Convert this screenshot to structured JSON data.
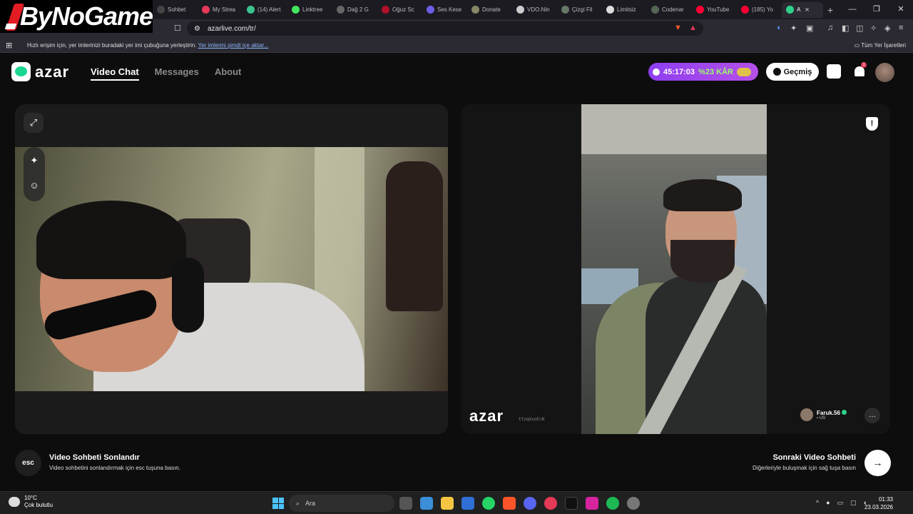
{
  "overlay": {
    "logo": "ByNoGame"
  },
  "tabs": [
    {
      "label": "Sohbet",
      "color": "#444444"
    },
    {
      "label": "My Strea",
      "color": "#e53957"
    },
    {
      "label": "(14) Alert",
      "color": "#3cc48f"
    },
    {
      "label": "Linktree",
      "color": "#43e660"
    },
    {
      "label": "Dağ 2 G",
      "color": "#666666"
    },
    {
      "label": "Oğuz Sc",
      "color": "#b0102a"
    },
    {
      "label": "Ses Kese",
      "color": "#6d5fe8"
    },
    {
      "label": "Donate",
      "color": "#888866"
    },
    {
      "label": "VDO.Nin",
      "color": "#cccccc"
    },
    {
      "label": "Çizgi Fil",
      "color": "#667766"
    },
    {
      "label": "Limitsiz",
      "color": "#dddddd"
    },
    {
      "label": "Codenar",
      "color": "#556655"
    },
    {
      "label": "YouTube",
      "color": "#ff0033"
    },
    {
      "label": "(185) Yo",
      "color": "#ff0033"
    },
    {
      "label": "A",
      "color": "#2fd28a"
    }
  ],
  "browser": {
    "url": "azarlive.com/tr/",
    "bookmark_hint": "Hızlı erişim için, yer imlerinizi buradaki yer imi çubuğuna yerleştirin.",
    "bookmark_link": "Yer imlerini şimdi içe aktar...",
    "all_bookmarks": "Tüm Yer İşaretleri",
    "new_tab": "+"
  },
  "site": {
    "nav": [
      "Video Chat",
      "Messages",
      "About"
    ],
    "timer": "45:17:03",
    "profit": "%23 KÂR",
    "history": "Geçmiş",
    "notification_count": "1"
  },
  "partner": {
    "name": "Faruk.56",
    "country": "US",
    "watermark": "azar",
    "code": "ttzqXxoEcN"
  },
  "footer": {
    "esc": "esc",
    "end_title": "Video Sohbeti Sonlandır",
    "end_desc": "Video sohbetini sonlandırmak için esc tuşuna basın.",
    "next_title": "Sonraki Video Sohbeti",
    "next_desc": "Diğerleriyle buluşmak için sağ tuşa basın",
    "next_arrow": "→"
  },
  "taskbar": {
    "temp": "10°C",
    "weather": "Çok bulutlu",
    "search": "Ara",
    "time": "01:33",
    "date": "23.03.2026"
  }
}
